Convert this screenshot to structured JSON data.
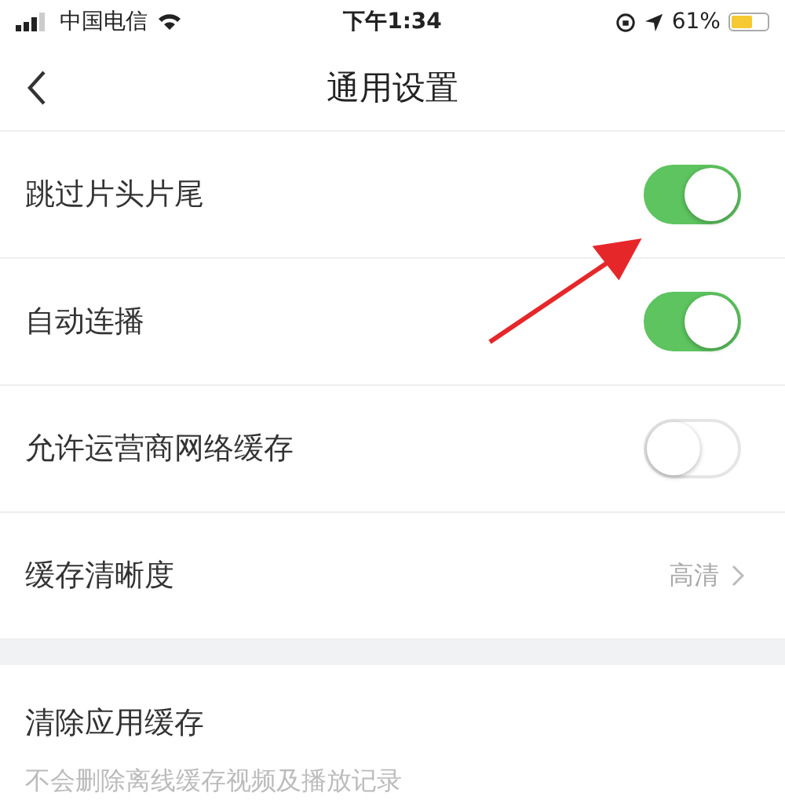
{
  "status_bar": {
    "carrier": "中国电信",
    "time": "下午1:34",
    "battery_percent": "61%"
  },
  "nav": {
    "title": "通用设置"
  },
  "settings": [
    {
      "kind": "toggle",
      "label": "跳过片头片尾",
      "on": true
    },
    {
      "kind": "toggle",
      "label": "自动连播",
      "on": true
    },
    {
      "kind": "toggle",
      "label": "允许运营商网络缓存",
      "on": false
    },
    {
      "kind": "value",
      "label": "缓存清晰度",
      "value": "高清"
    }
  ],
  "cache_section": {
    "title": "清除应用缓存",
    "subtitle": "不会删除离线缓存视频及播放记录"
  }
}
